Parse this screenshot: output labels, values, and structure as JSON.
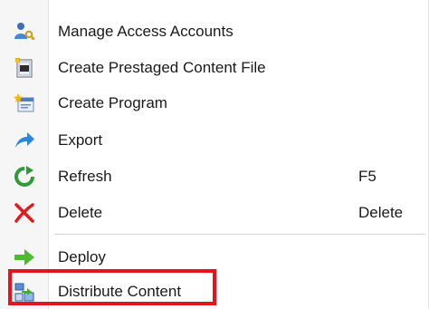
{
  "menu": {
    "items": [
      {
        "label": "Manage Access Accounts",
        "shortcut": "",
        "icon": "users-key-icon"
      },
      {
        "label": "Create Prestaged Content File",
        "shortcut": "",
        "icon": "prestaged-file-icon"
      },
      {
        "label": "Create Program",
        "shortcut": "",
        "icon": "new-program-icon"
      },
      {
        "label": "Export",
        "shortcut": "",
        "icon": "export-arrow-icon"
      },
      {
        "label": "Refresh",
        "shortcut": "F5",
        "icon": "refresh-icon"
      },
      {
        "label": "Delete",
        "shortcut": "Delete",
        "icon": "delete-x-icon"
      },
      {
        "label": "Deploy",
        "shortcut": "",
        "icon": "deploy-arrow-icon"
      },
      {
        "label": "Distribute Content",
        "shortcut": "",
        "icon": "distribute-content-icon"
      }
    ]
  },
  "highlight": {
    "color": "#e3141b",
    "target": "Distribute Content"
  }
}
